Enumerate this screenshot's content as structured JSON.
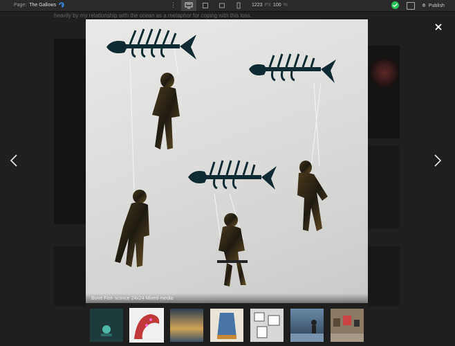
{
  "toolbar": {
    "page_label": "Page:",
    "page_name": "The Gallows",
    "width_value": "1223",
    "width_unit": "PX",
    "zoom_value": "100",
    "zoom_unit": "%",
    "publish_label": "Publish"
  },
  "background": {
    "intro_text": "heavily by my relationship with the ocean as a metaphor for coping with this loss."
  },
  "lightbox": {
    "caption": "Bone Fish sconce 24x24 Mixed media"
  },
  "thumbnails": [
    {
      "name": "thumb-green-figure",
      "color": "#1f3a3a"
    },
    {
      "name": "thumb-red-tentacle",
      "color": "#c23838"
    },
    {
      "name": "thumb-blue-landscape",
      "color": "#3f5e7a"
    },
    {
      "name": "thumb-blue-dress",
      "color": "#4a73a6"
    },
    {
      "name": "thumb-white-panels",
      "color": "#d8d8d8"
    },
    {
      "name": "thumb-figures-sea",
      "color": "#5b7c9a"
    },
    {
      "name": "thumb-gallery-room",
      "color": "#8a7a66"
    }
  ]
}
